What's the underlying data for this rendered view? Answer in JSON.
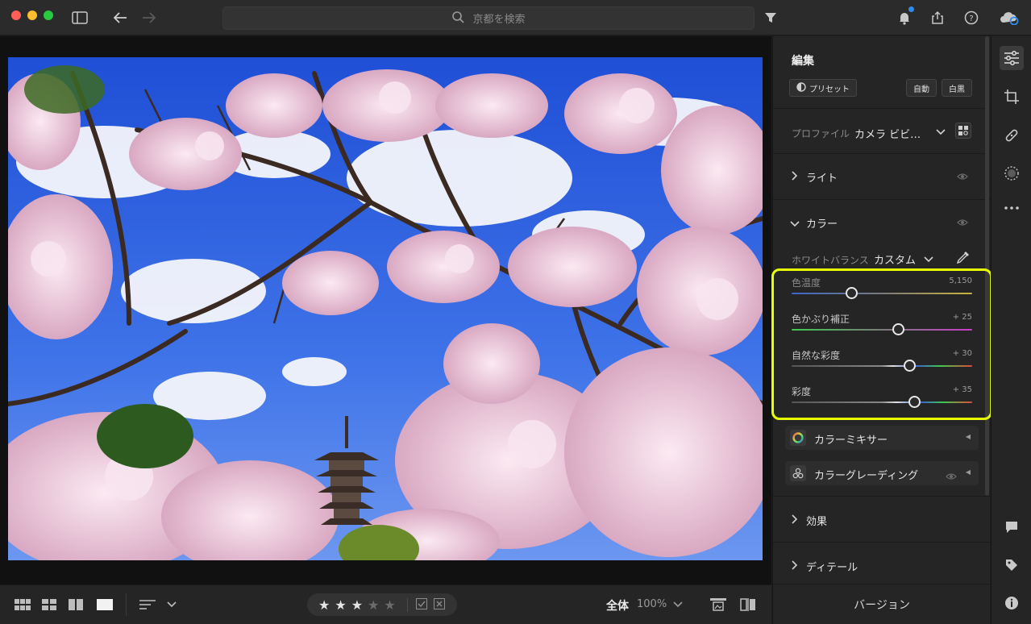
{
  "titlebar": {
    "search_placeholder": "京都を検索",
    "icons": [
      "sidebar-toggle-icon",
      "back-arrow-icon",
      "forward-arrow-icon",
      "search-icon",
      "filter-icon",
      "bell-icon",
      "share-icon",
      "help-icon",
      "cloud-icon"
    ],
    "notification_color": "#2d8ceb"
  },
  "edit_panel": {
    "title": "編集",
    "preset_button": "プリセット",
    "auto_button": "自動",
    "bw_button": "白黒",
    "profile_label": "プロファイル",
    "profile_value": "カメラ ビビ…",
    "sections": {
      "light": "ライト",
      "color": "カラー",
      "effects": "効果",
      "detail": "ディテール"
    },
    "white_balance_label": "ホワイトバランス",
    "white_balance_value": "カスタム",
    "sliders": [
      {
        "label": "色温度",
        "value": "5,150",
        "position": 0.33
      },
      {
        "label": "色かぶり補正",
        "value": "+ 25",
        "position": 0.59
      },
      {
        "label": "自然な彩度",
        "value": "+ 30",
        "position": 0.65
      },
      {
        "label": "彩度",
        "value": "+ 35",
        "position": 0.68
      }
    ],
    "color_mixer": "カラーミキサー",
    "color_grading": "カラーグレーディング",
    "version_button": "バージョン",
    "highlight_color": "#e8ff00"
  },
  "bottombar": {
    "rating": 3,
    "rating_max": 5,
    "zoom_label": "全体",
    "zoom_value": "100%"
  },
  "toolstrip": {
    "icons": [
      "edit-sliders-icon",
      "crop-icon",
      "healing-icon",
      "mask-icon",
      "more-icon",
      "comment-icon",
      "tag-icon",
      "info-icon"
    ]
  }
}
